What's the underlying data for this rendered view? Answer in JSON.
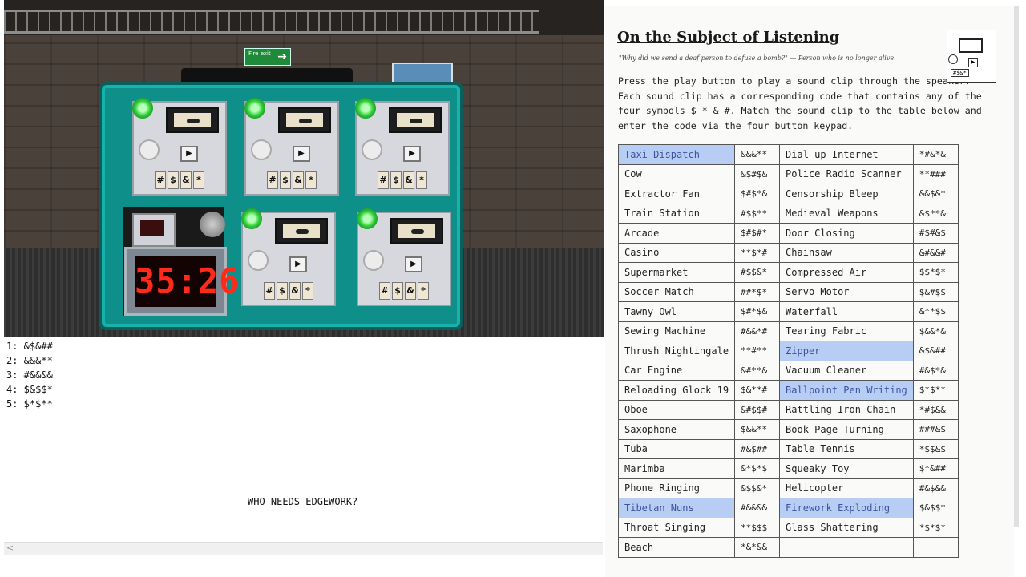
{
  "game": {
    "exit_sign": "Fire exit",
    "exit_arrow": "➔",
    "timer": "35:26",
    "modules": [
      {
        "play_label": "▶",
        "keys": [
          "#",
          "$",
          "&",
          "*"
        ]
      },
      {
        "play_label": "▶",
        "keys": [
          "#",
          "$",
          "&",
          "*"
        ]
      },
      {
        "play_label": "▶",
        "keys": [
          "#",
          "$",
          "&",
          "*"
        ]
      },
      {
        "play_label": "▶",
        "keys": [
          "#",
          "$",
          "&",
          "*"
        ]
      },
      {
        "play_label": "▶",
        "keys": [
          "#",
          "$",
          "&",
          "*"
        ]
      }
    ]
  },
  "log": {
    "lines": [
      "1: &$&##",
      "2: &&&**",
      "3: #&&&&",
      "4: $&$$*",
      "5: $*$**"
    ],
    "slogan": "WHO NEEDS EDGEWORK?",
    "scroll_arrow": "<"
  },
  "manual": {
    "title": "On the Subject of Listening",
    "quote": "\"Why did we send a deaf person to defuse a bomb?\" — Person who is no longer alive.",
    "body": "Press the play button to play a sound clip through the speaker. Each sound clip has a corresponding code that contains any of the four symbols $ * & #. Match the sound clip to the table below and enter the code via the four button keypad.",
    "icon_play": "▶",
    "icon_keys": "#$&*",
    "table": [
      {
        "n1": "Taxi Dispatch",
        "c1": "&&&**",
        "n2": "Dial-up Internet",
        "c2": "*#&*&",
        "hl1": true,
        "hl2": false
      },
      {
        "n1": "Cow",
        "c1": "&$#$&",
        "n2": "Police Radio Scanner",
        "c2": "**###",
        "hl1": false,
        "hl2": false
      },
      {
        "n1": "Extractor Fan",
        "c1": "$#$*&",
        "n2": "Censorship Bleep",
        "c2": "&&$&*",
        "hl1": false,
        "hl2": false
      },
      {
        "n1": "Train Station",
        "c1": "#$$**",
        "n2": "Medieval Weapons",
        "c2": "&$**&",
        "hl1": false,
        "hl2": false
      },
      {
        "n1": "Arcade",
        "c1": "$#$#*",
        "n2": "Door Closing",
        "c2": "#$#&$",
        "hl1": false,
        "hl2": false
      },
      {
        "n1": "Casino",
        "c1": "**$*#",
        "n2": "Chainsaw",
        "c2": "&#&&#",
        "hl1": false,
        "hl2": false
      },
      {
        "n1": "Supermarket",
        "c1": "#$$&*",
        "n2": "Compressed Air",
        "c2": "$$*$*",
        "hl1": false,
        "hl2": false
      },
      {
        "n1": "Soccer Match",
        "c1": "##*$*",
        "n2": "Servo Motor",
        "c2": "$&#$$",
        "hl1": false,
        "hl2": false
      },
      {
        "n1": "Tawny Owl",
        "c1": "$#*$&",
        "n2": "Waterfall",
        "c2": "&**$$",
        "hl1": false,
        "hl2": false
      },
      {
        "n1": "Sewing Machine",
        "c1": "#&&*#",
        "n2": "Tearing Fabric",
        "c2": "$&&*&",
        "hl1": false,
        "hl2": false
      },
      {
        "n1": "Thrush Nightingale",
        "c1": "**#**",
        "n2": "Zipper",
        "c2": "&$&##",
        "hl1": false,
        "hl2": true
      },
      {
        "n1": "Car Engine",
        "c1": "&#**&",
        "n2": "Vacuum Cleaner",
        "c2": "#&$*&",
        "hl1": false,
        "hl2": false
      },
      {
        "n1": "Reloading Glock 19",
        "c1": "$&**#",
        "n2": "Ballpoint Pen Writing",
        "c2": "$*$**",
        "hl1": false,
        "hl2": true
      },
      {
        "n1": "Oboe",
        "c1": "&#$$#",
        "n2": "Rattling Iron Chain",
        "c2": "*#$&&",
        "hl1": false,
        "hl2": false
      },
      {
        "n1": "Saxophone",
        "c1": "$&&**",
        "n2": "Book Page Turning",
        "c2": "###&$",
        "hl1": false,
        "hl2": false
      },
      {
        "n1": "Tuba",
        "c1": "#&$##",
        "n2": "Table Tennis",
        "c2": "*$$&$",
        "hl1": false,
        "hl2": false
      },
      {
        "n1": "Marimba",
        "c1": "&*$*$",
        "n2": "Squeaky Toy",
        "c2": "$*&##",
        "hl1": false,
        "hl2": false
      },
      {
        "n1": "Phone Ringing",
        "c1": "&$$&*",
        "n2": "Helicopter",
        "c2": "#&$&&",
        "hl1": false,
        "hl2": false
      },
      {
        "n1": "Tibetan Nuns",
        "c1": "#&&&&",
        "n2": "Firework Exploding",
        "c2": "$&$$*",
        "hl1": true,
        "hl2": true
      },
      {
        "n1": "Throat Singing",
        "c1": "**$$$",
        "n2": "Glass Shattering",
        "c2": "*$*$*",
        "hl1": false,
        "hl2": false
      },
      {
        "n1": "Beach",
        "c1": "*&*&&",
        "n2": "",
        "c2": "",
        "hl1": false,
        "hl2": false
      }
    ]
  }
}
